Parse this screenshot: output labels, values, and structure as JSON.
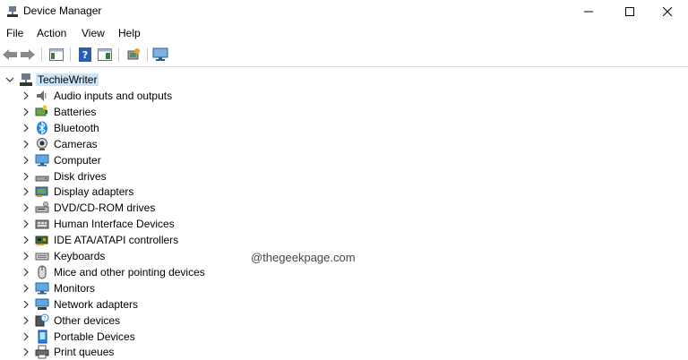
{
  "window": {
    "title": "Device Manager"
  },
  "menu": [
    "File",
    "Action",
    "View",
    "Help"
  ],
  "tree": {
    "root": "TechieWriter",
    "items": [
      {
        "label": "Audio inputs and outputs",
        "icon": "speaker-icon"
      },
      {
        "label": "Batteries",
        "icon": "battery-icon"
      },
      {
        "label": "Bluetooth",
        "icon": "bluetooth-icon"
      },
      {
        "label": "Cameras",
        "icon": "camera-icon"
      },
      {
        "label": "Computer",
        "icon": "monitor-icon"
      },
      {
        "label": "Disk drives",
        "icon": "disk-drive-icon"
      },
      {
        "label": "Display adapters",
        "icon": "display-adapter-icon"
      },
      {
        "label": "DVD/CD-ROM drives",
        "icon": "dvd-drive-icon"
      },
      {
        "label": "Human Interface Devices",
        "icon": "hid-icon"
      },
      {
        "label": "IDE ATA/ATAPI controllers",
        "icon": "ide-controller-icon"
      },
      {
        "label": "Keyboards",
        "icon": "keyboard-icon"
      },
      {
        "label": "Mice and other pointing devices",
        "icon": "mouse-icon"
      },
      {
        "label": "Monitors",
        "icon": "monitor-icon"
      },
      {
        "label": "Network adapters",
        "icon": "network-icon"
      },
      {
        "label": "Other devices",
        "icon": "other-devices-icon"
      },
      {
        "label": "Portable Devices",
        "icon": "portable-device-icon"
      },
      {
        "label": "Print queues",
        "icon": "printer-icon"
      }
    ]
  },
  "watermark": "@thegeekpage.com",
  "colors": {
    "selection": "#cce4f7",
    "icon_blue": "#1e88e5"
  }
}
